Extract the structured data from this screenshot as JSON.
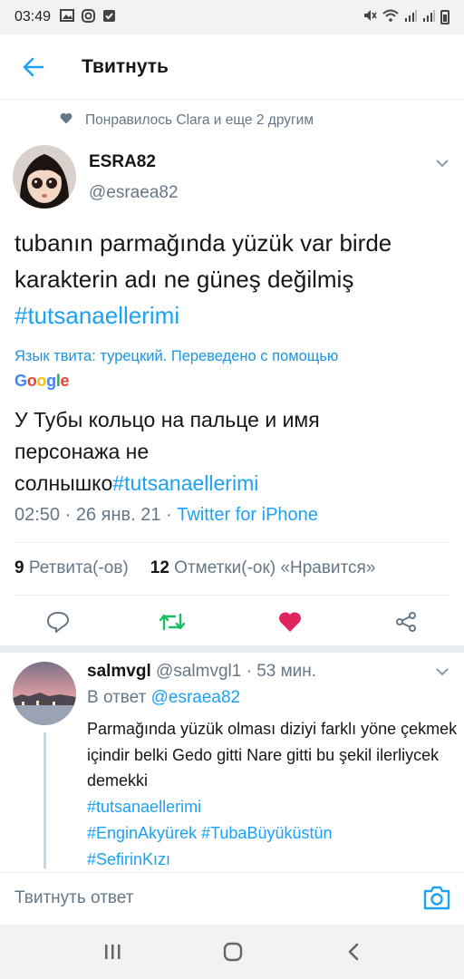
{
  "status_bar": {
    "time": "03:49",
    "left_icons": [
      "image-icon",
      "instagram-icon",
      "checkbox-icon"
    ],
    "right_icons": [
      "mute-icon",
      "wifi-icon",
      "signal-icon",
      "signal-icon",
      "battery-icon"
    ]
  },
  "header": {
    "title": "Твитнуть",
    "back_icon": "arrow-left-icon"
  },
  "liked_by": {
    "text": "Понравилось Clara и еще 2 другим",
    "icon": "heart-icon"
  },
  "tweet": {
    "author_name": "ESRA82",
    "author_handle": "@esraea82",
    "text": "tubanın parmağında yüzük var birde karakterin adı ne güneş değilmiş ",
    "hashtag": "#tutsanaellerimi",
    "translation_note": "Язык твита: турецкий. Переведено с помощью",
    "google_letters": [
      "G",
      "o",
      "o",
      "g",
      "l",
      "e"
    ],
    "translation_text": "У Тубы кольцо на пальце и имя персонажа не солнышко",
    "translation_hashtag": "#tutsanaellerimi",
    "time": "02:50",
    "date": "26 янв. 21",
    "source": "Twitter for iPhone",
    "retweets_count": "9",
    "retweets_label": "Ретвита(-ов)",
    "likes_count": "12",
    "likes_label": "Отметки(-ок) «Нравится»"
  },
  "actions": {
    "reply_icon": "reply-icon",
    "retweet_icon": "retweet-icon",
    "like_icon": "heart-filled-icon",
    "share_icon": "share-icon",
    "retweet_color": "#17bf63",
    "like_color": "#e0245e"
  },
  "reply": {
    "name": "salmvgl",
    "handle": "@salmvgl1",
    "time": "53 мин.",
    "in_reply_prefix": "В ответ",
    "in_reply_mention": "@esraea82",
    "text": "Parmağında yüzük olması diziyi farklı yöne çekmek içindir belki Gedo gitti Nare gitti bu şekil ilerliycek demekki",
    "tag1": "#tutsanaellerimi",
    "tag2": "#EnginAkyürek #TubaBüyüküstün",
    "tag3": "#SefirinKızı"
  },
  "composer": {
    "placeholder": "Твитнуть ответ",
    "camera_icon": "camera-icon"
  },
  "nav": {
    "icons": [
      "recent-apps-icon",
      "home-icon",
      "back-icon"
    ]
  },
  "colors": {
    "accent": "#1da1f2",
    "muted": "#657786",
    "text": "#14171a"
  }
}
